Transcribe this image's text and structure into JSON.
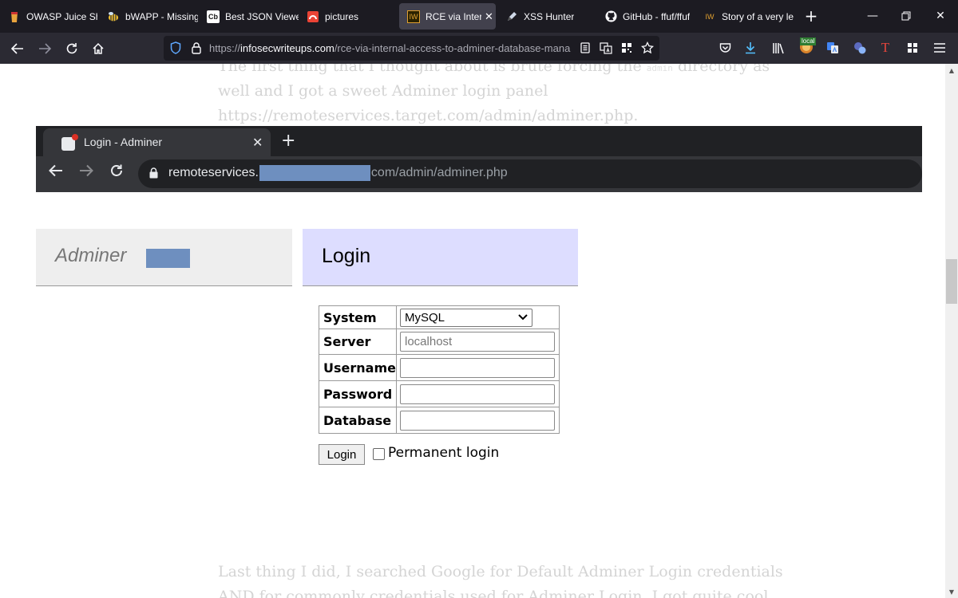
{
  "browser": {
    "tabs": [
      {
        "label": "OWASP Juice Sho",
        "icon": "juice-shop-icon"
      },
      {
        "label": "bWAPP - Missing",
        "icon": "bee-icon"
      },
      {
        "label": "Best JSON Viewe",
        "icon": "cb-icon",
        "icon_text": "Cb"
      },
      {
        "label": "pictures",
        "icon": "pictures-icon"
      },
      {
        "label": "RCE via Interna",
        "icon": "iw-icon",
        "icon_text": "IW",
        "active": true
      },
      {
        "label": "XSS Hunter",
        "icon": "pen-icon"
      },
      {
        "label": "GitHub - ffuf/ffuf",
        "icon": "github-icon"
      },
      {
        "label": "Story of a very le",
        "icon": "iw-icon",
        "icon_text": "IW"
      }
    ],
    "url": {
      "prefix": "https://",
      "host": "infosecwriteups.com",
      "path": "/rce-via-internal-access-to-adminer-database-mana"
    },
    "extension_badge": "local"
  },
  "article": {
    "line1": "The first thing that I thought about is brute forcing the ",
    "line1_code": "admin",
    "line1_end": " directory as",
    "line2": "well and I got a sweet Adminer login panel",
    "line3": "https://remoteservices.target.com/admin/adminer.php.",
    "bottom_line1": "Last thing I did, I searched Google for Default Adminer Login credentials",
    "bottom_line2": "AND for commonly credentials used for Adminer Login. I got quite cool"
  },
  "inner_browser": {
    "tab_title": "Login - Adminer",
    "url_host": "remoteservices.",
    "url_path_host_end": "com",
    "url_path": "/admin/adminer.php"
  },
  "adminer": {
    "logo": "Adminer",
    "heading": "Login",
    "fields": {
      "system_label": "System",
      "system_value": "MySQL",
      "server_label": "Server",
      "server_placeholder": "localhost",
      "username_label": "Username",
      "password_label": "Password",
      "database_label": "Database"
    },
    "login_button": "Login",
    "permanent_login": "Permanent login"
  }
}
